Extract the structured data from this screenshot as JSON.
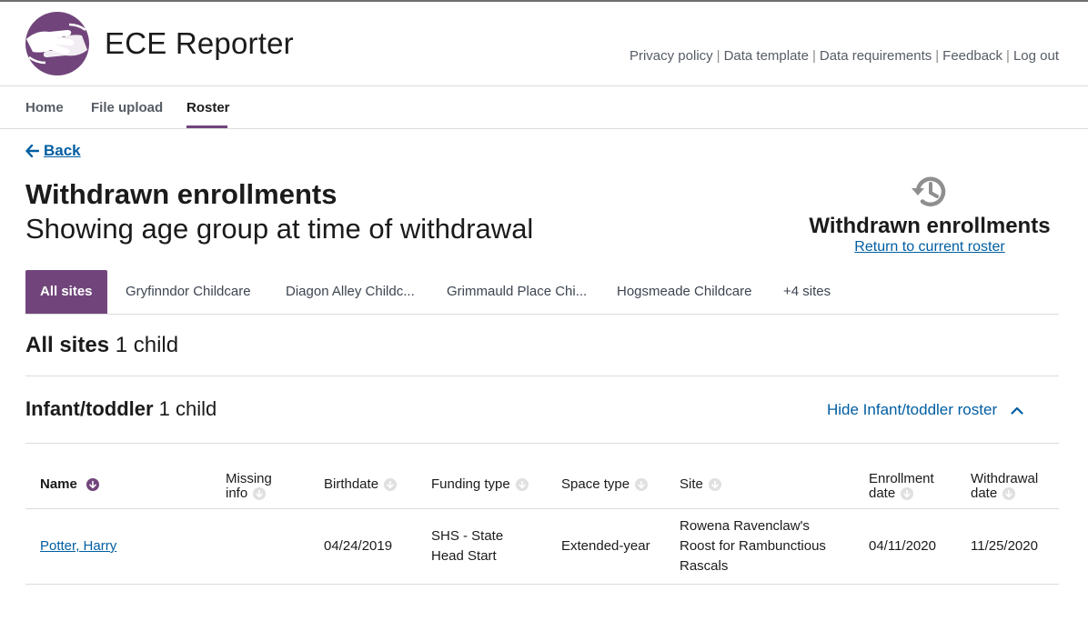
{
  "app": {
    "title": "ECE Reporter",
    "brand_color": "#71457b",
    "logo_icon": "hands-logo-icon"
  },
  "utility_links": [
    "Privacy policy",
    "Data template",
    "Data requirements",
    "Feedback",
    "Log out"
  ],
  "nav": {
    "items": [
      {
        "label": "Home",
        "active": false
      },
      {
        "label": "File upload",
        "active": false
      },
      {
        "label": "Roster",
        "active": true
      }
    ]
  },
  "back": {
    "label": "Back",
    "icon": "arrow-left-icon"
  },
  "page": {
    "title": "Withdrawn enrollments",
    "subtitle": "Showing age group at time of withdrawal"
  },
  "panel": {
    "icon": "history-icon",
    "title": "Withdrawn enrollments",
    "link": "Return to current roster"
  },
  "site_tabs": [
    {
      "label": "All sites",
      "active": true
    },
    {
      "label": "Gryfinndor Childcare",
      "active": false
    },
    {
      "label": "Diagon Alley Childc...",
      "active": false
    },
    {
      "label": "Grimmauld Place Chi...",
      "active": false
    },
    {
      "label": "Hogsmeade Childcare",
      "active": false
    },
    {
      "label": "+4 sites",
      "active": false
    }
  ],
  "summary": {
    "label": "All sites",
    "count": "1 child"
  },
  "group": {
    "label": "Infant/toddler",
    "count": "1 child",
    "toggle": "Hide Infant/toddler roster"
  },
  "table": {
    "columns": [
      {
        "line1": "Name",
        "line2": ""
      },
      {
        "line1": "Missing",
        "line2": "info"
      },
      {
        "line1": "Birthdate",
        "line2": ""
      },
      {
        "line1": "Funding type",
        "line2": ""
      },
      {
        "line1": "Space type",
        "line2": ""
      },
      {
        "line1": "Site",
        "line2": ""
      },
      {
        "line1": "Enrollment",
        "line2": "date"
      },
      {
        "line1": "Withdrawal",
        "line2": "date"
      }
    ],
    "rows": [
      {
        "name": "Potter, Harry",
        "missing_info": "",
        "birthdate": "04/24/2019",
        "funding_type": [
          "SHS - State",
          "Head Start"
        ],
        "space_type": "Extended-year",
        "site": [
          "Rowena Ravenclaw's",
          "Roost for Rambunctious",
          "Rascals"
        ],
        "enrollment_date": "04/11/2020",
        "withdrawal_date": "11/25/2020"
      }
    ]
  }
}
